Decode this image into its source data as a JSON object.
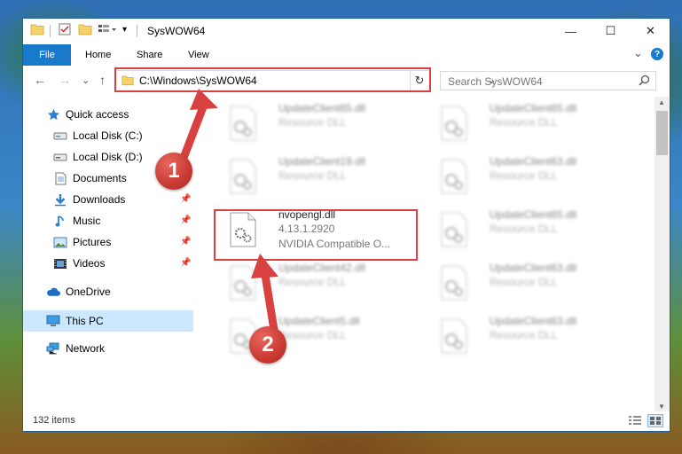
{
  "window": {
    "title": "SysWOW64",
    "controls": {
      "minimize": "—",
      "maximize": "☐",
      "close": "✕"
    }
  },
  "ribbon": {
    "file": "File",
    "tabs": [
      "Home",
      "Share",
      "View"
    ],
    "expand": "⌄",
    "help": "?"
  },
  "address_bar": {
    "path": "C:\\Windows\\SysWOW64",
    "dropdown": "⌄",
    "refresh": "↻"
  },
  "search": {
    "placeholder": "Search SysWOW64"
  },
  "nav": {
    "back": "←",
    "forward": "→",
    "recent": "⌄",
    "up": "↑"
  },
  "sidebar": {
    "items": [
      {
        "label": "Quick access",
        "icon": "star-icon"
      },
      {
        "label": "Local Disk (C:)",
        "icon": "drive-icon"
      },
      {
        "label": "Local Disk (D:)",
        "icon": "drive-icon"
      },
      {
        "label": "Documents",
        "icon": "documents-icon"
      },
      {
        "label": "Downloads",
        "icon": "download-icon"
      },
      {
        "label": "Music",
        "icon": "music-icon"
      },
      {
        "label": "Pictures",
        "icon": "pictures-icon"
      },
      {
        "label": "Videos",
        "icon": "videos-icon"
      },
      {
        "label": "OneDrive",
        "icon": "cloud-icon"
      },
      {
        "label": "This PC",
        "icon": "computer-icon"
      },
      {
        "label": "Network",
        "icon": "network-icon"
      }
    ]
  },
  "files": {
    "col1": [
      {
        "name": "UpdateClient65.dll",
        "desc": "Resource DLL"
      },
      {
        "name": "UpdateClient19.dll",
        "desc": "Resource DLL"
      },
      {
        "name": "nvopengl.dll",
        "desc": "4.13.1.2920",
        "desc2": "NVIDIA Compatible O..."
      },
      {
        "name": "UpdateClient42.dll",
        "desc": "Resource DLL"
      },
      {
        "name": "UpdateClient5.dll",
        "desc": "Resource DLL"
      }
    ],
    "col2": [
      {
        "name": "UpdateClient65.dll",
        "desc": "Resource DLL"
      },
      {
        "name": "UpdateClient63.dll",
        "desc": "Resource DLL"
      },
      {
        "name": "UpdateClient65.dll",
        "desc": "Resource DLL"
      },
      {
        "name": "UpdateClient63.dll",
        "desc": "Resource DLL"
      },
      {
        "name": "UpdateClient63.dll",
        "desc": "Resource DLL"
      }
    ]
  },
  "status": {
    "count": "132 items"
  },
  "annotations": {
    "step1": "1",
    "step2": "2",
    "color": "#d94040"
  }
}
